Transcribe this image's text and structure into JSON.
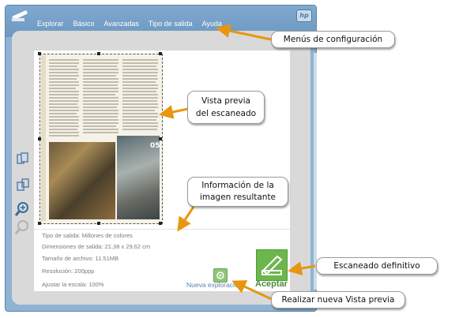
{
  "window": {
    "menu": [
      "Explorar",
      "Básico",
      "Avanzadas",
      "Tipo de salida",
      "Ayuda"
    ],
    "brand": "hp"
  },
  "preview": {
    "photo_label": "05"
  },
  "info": {
    "tipo": "Tipo de salida: Millones de colores",
    "dimensiones": "Dimensiones de salida: 21,38 x 29,62 cm",
    "tamano": "Tamaño de archivo: 11.51MB",
    "resolucion": "Resolución:  200ppp",
    "escala": "Ajustar la escala: 100%"
  },
  "buttons": {
    "new_scan": "Nueva exploración",
    "accept": "Aceptar"
  },
  "callouts": {
    "menus": "Menús de configuración",
    "preview": [
      "Vista previa",
      "del escaneado"
    ],
    "info": [
      "Información de la",
      "imagen resultante"
    ],
    "final": "Escaneado definitivo",
    "new_preview": "Realizar nueva Vista previa"
  },
  "colors": {
    "window_blue": "#8fb3d3",
    "accept_green": "#6cb64e",
    "arrow_orange": "#e8960f"
  },
  "icons": [
    "scanner-logo-icon",
    "hp-logo-icon",
    "rotate-icon",
    "mirror-icon",
    "zoom-in-icon",
    "zoom-out-icon",
    "new-scan-icon",
    "scanner-accept-icon"
  ]
}
